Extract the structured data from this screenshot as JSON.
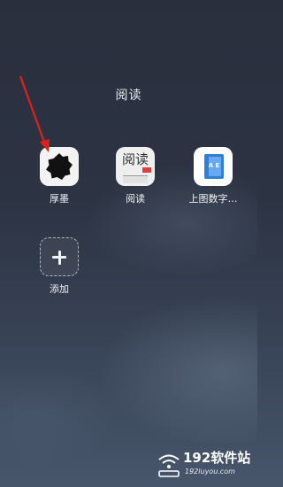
{
  "folder": {
    "title": "阅读"
  },
  "apps": [
    {
      "label": "厚墨",
      "icon": "houmo-app-icon"
    },
    {
      "label": "阅读",
      "icon": "yuedu-app-icon",
      "icon_text": "阅读"
    },
    {
      "label": "上图数字…",
      "icon": "shangtu-digital-app-icon"
    }
  ],
  "add_tile": {
    "label": "添加",
    "icon": "plus-icon"
  },
  "annotation": {
    "icon": "red-arrow-icon",
    "color": "#e0201b"
  },
  "watermark": {
    "name": "192软件站",
    "url": "192luyou.com"
  }
}
